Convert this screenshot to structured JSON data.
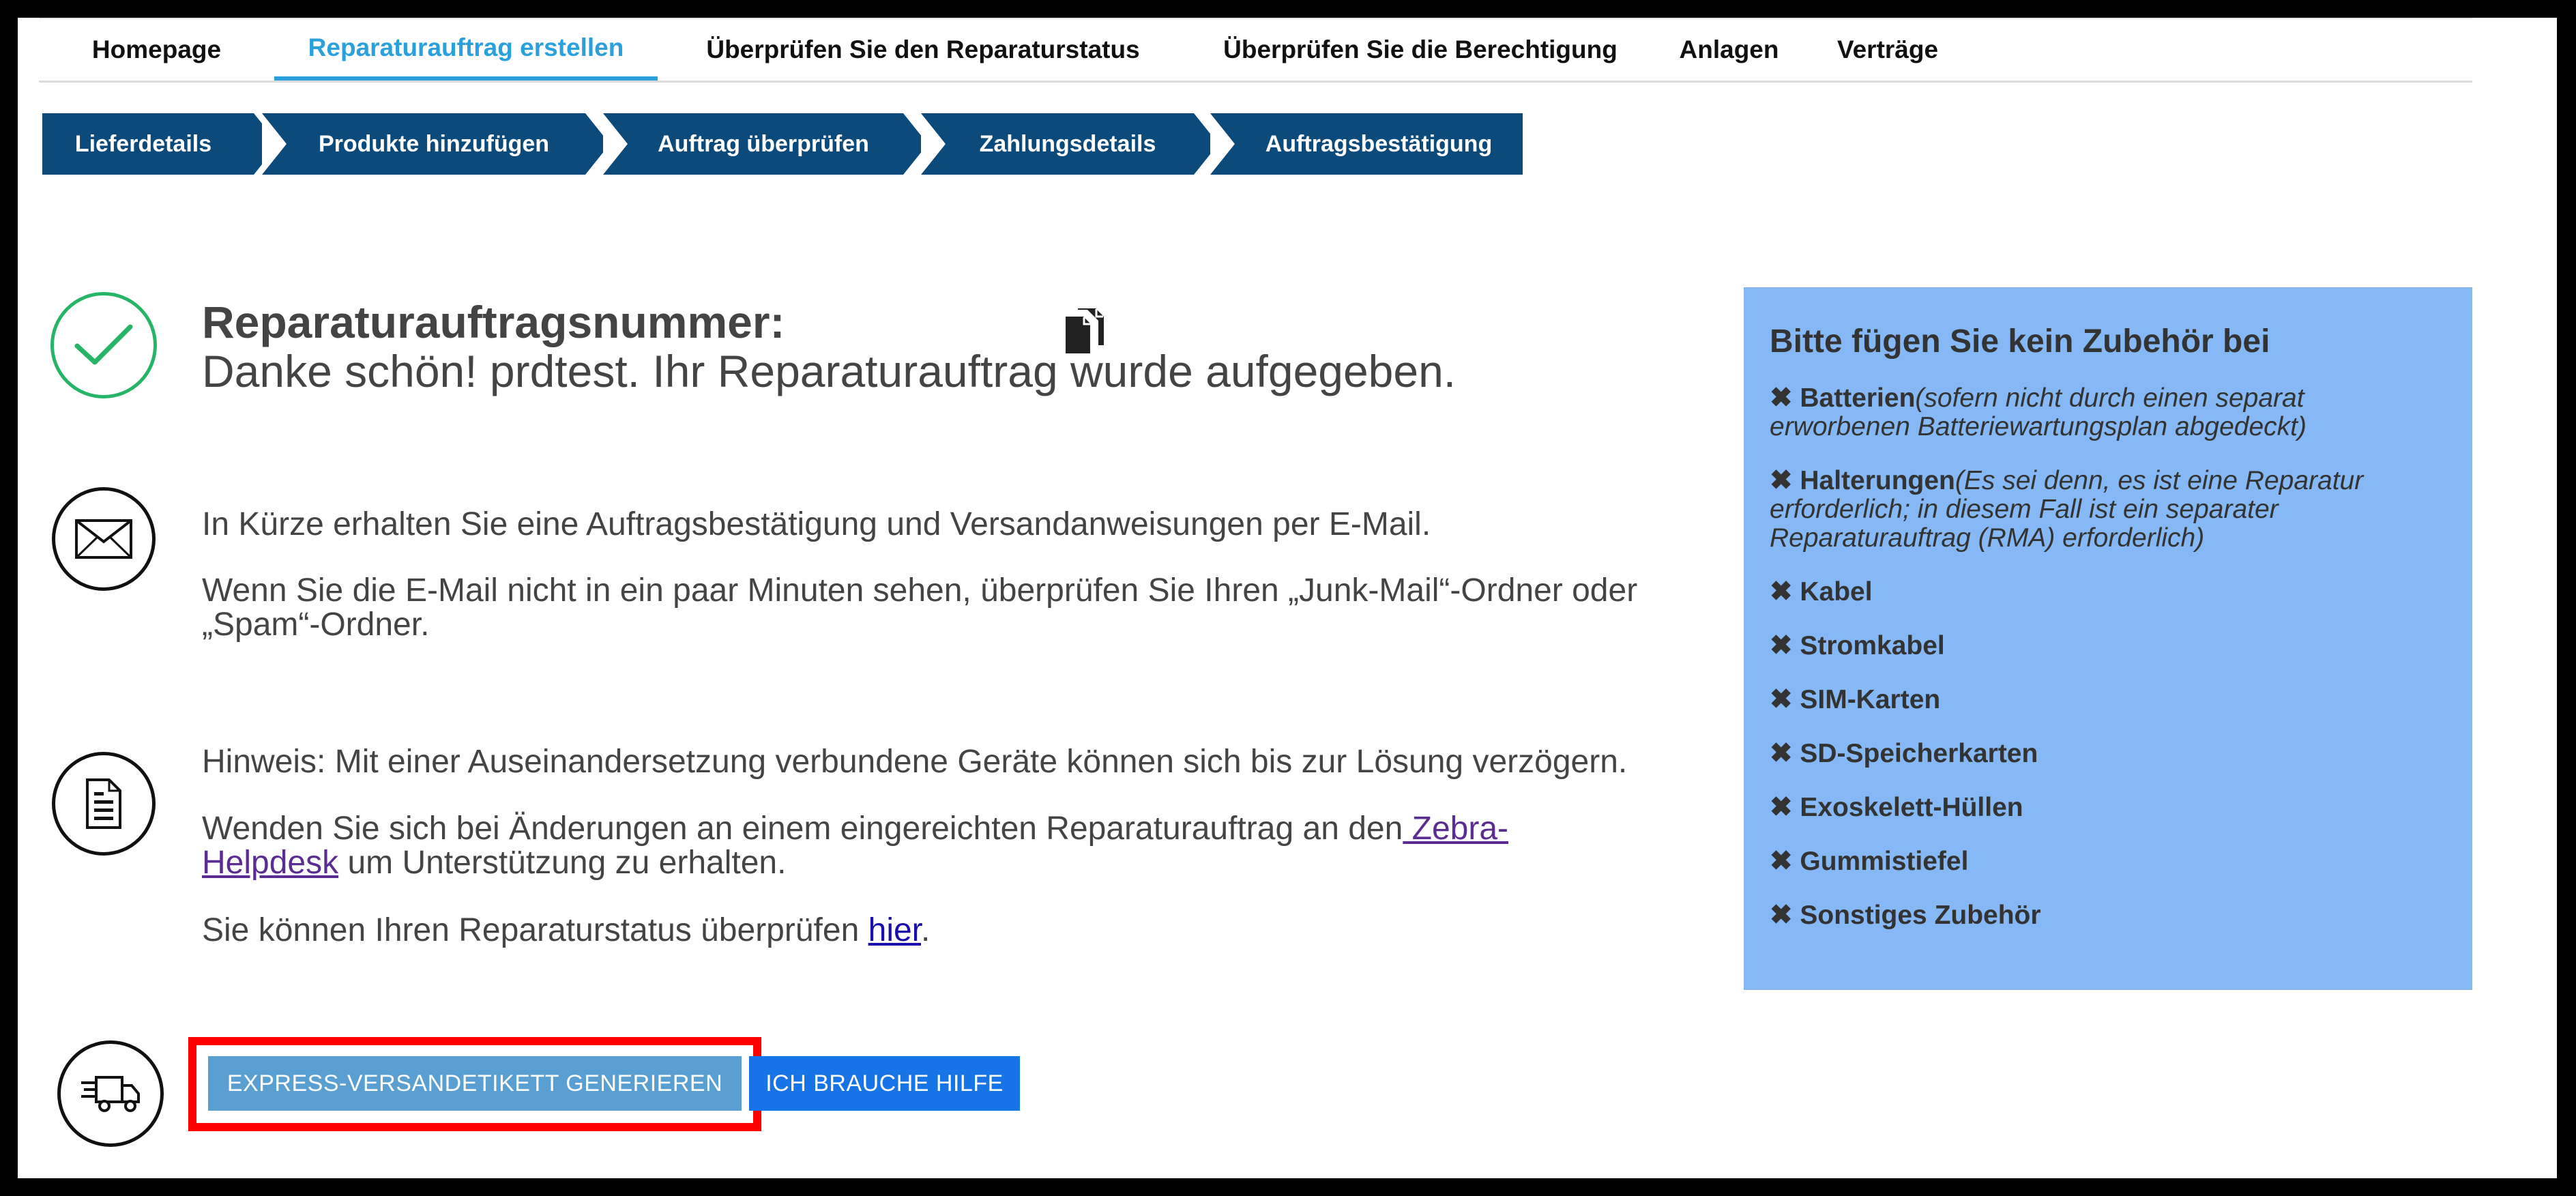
{
  "nav": {
    "tabs": [
      {
        "label": "Homepage",
        "active": false
      },
      {
        "label": "Reparaturauftrag erstellen",
        "active": true
      },
      {
        "label": "Überprüfen Sie den Reparaturstatus",
        "active": false
      },
      {
        "label": "Überprüfen Sie die Berechtigung",
        "active": false
      },
      {
        "label": "Anlagen",
        "active": false
      },
      {
        "label": "Verträge",
        "active": false
      }
    ]
  },
  "stepper": {
    "steps": [
      "Lieferdetails",
      "Produkte hinzufügen",
      "Auftrag überprüfen",
      "Zahlungsdetails",
      "Auftragsbestätigung"
    ]
  },
  "confirmation": {
    "title": "Reparaturauftragsnummer:",
    "thanks": "Danke schön! prdtest. Ihr Reparaturauftrag wurde aufgegeben.",
    "copy_icon": "copy-icon"
  },
  "email_section": {
    "line1": "In Kürze erhalten Sie eine Auftragsbestätigung und Versandanweisungen per E-Mail.",
    "line2": "Wenn Sie die E-Mail nicht in ein paar Minuten sehen, überprüfen Sie Ihren „Junk-Mail“-Ordner oder „Spam“-Ordner."
  },
  "note_section": {
    "line1": "Hinweis: Mit einer Auseinandersetzung verbundene Geräte können sich bis zur Lösung verzögern.",
    "line2_before": "Wenden Sie sich bei Änderungen an einem eingereichten Reparaturauftrag an den",
    "line2_link": " Zebra-Helpdesk",
    "line2_after": " um Unterstützung zu erhalten.",
    "line3_before": "Sie können Ihren Reparaturstatus überprüfen ",
    "line3_link": "hier",
    "line3_after": "."
  },
  "sidebox": {
    "title": "Bitte fügen Sie kein Zubehör bei",
    "mark": "✖",
    "items": [
      {
        "name": "Batterien",
        "note": "(sofern nicht durch einen separat erworbenen Batteriewartungsplan abgedeckt)"
      },
      {
        "name": "Halterungen",
        "note": "(Es sei denn, es ist eine Reparatur erforderlich; in diesem Fall ist ein separater Reparaturauftrag (RMA) erforderlich)"
      },
      {
        "name": "Kabel",
        "note": ""
      },
      {
        "name": "Stromkabel",
        "note": ""
      },
      {
        "name": "SIM-Karten",
        "note": ""
      },
      {
        "name": "SD-Speicherkarten",
        "note": ""
      },
      {
        "name": "Exoskelett-Hüllen",
        "note": ""
      },
      {
        "name": "Gummistiefel",
        "note": ""
      },
      {
        "name": "Sonstiges Zubehör",
        "note": ""
      }
    ]
  },
  "buttons": {
    "express_label": "EXPRESS-VERSANDETIKETT GENERIEREN",
    "help_label": "ICH BRAUCHE HILFE"
  },
  "colors": {
    "nav_active": "#2aa1dc",
    "stepper_bg": "#0d4a7c",
    "sidebox_bg": "#86b8f5",
    "express_button": "#5a9fd1",
    "help_button": "#1774e6",
    "highlight_border": "#ff0000",
    "check_green": "#26b566"
  }
}
